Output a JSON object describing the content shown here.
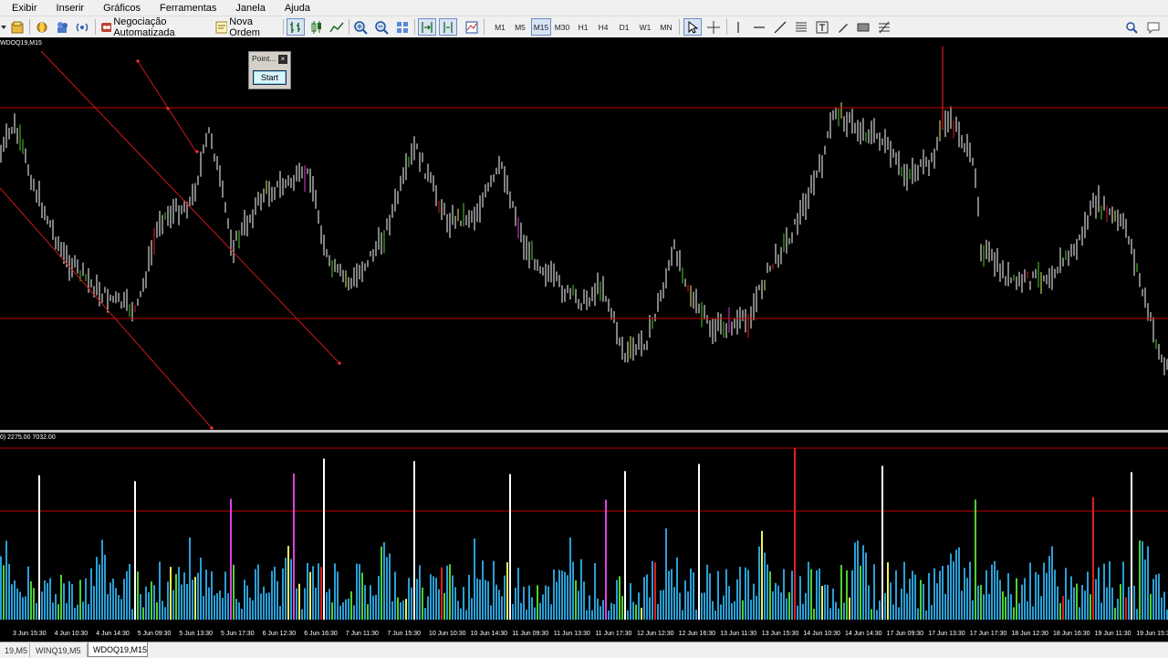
{
  "menu": [
    "Exibir",
    "Inserir",
    "Gráficos",
    "Ferramentas",
    "Janela",
    "Ajuda"
  ],
  "toolbar": {
    "algo_trading_label": "Negociação Automatizada",
    "new_order_label": "Nova Ordem",
    "timeframes": [
      "M1",
      "M5",
      "M15",
      "M30",
      "H1",
      "H4",
      "D1",
      "W1",
      "MN"
    ],
    "active_timeframe": "M15"
  },
  "chart": {
    "title": "WDOQ19,M15",
    "volume_label": "0) 2275.00 7032.00",
    "x_labels": [
      "3 Jun 15:30",
      "4 Jun 10:30",
      "4 Jun 14:30",
      "5 Jun 09:30",
      "5 Jun 13:30",
      "5 Jun 17:30",
      "6 Jun 12:30",
      "6 Jun 16:30",
      "7 Jun 11:30",
      "7 Jun 15:30",
      "10 Jun 10:30",
      "10 Jun 14:30",
      "11 Jun 09:30",
      "11 Jun 13:30",
      "11 Jun 17:30",
      "12 Jun 12:30",
      "12 Jun 16:30",
      "13 Jun 11:30",
      "13 Jun 15:30",
      "14 Jun 10:30",
      "14 Jun 14:30",
      "17 Jun 09:30",
      "17 Jun 13:30",
      "17 Jun 17:30",
      "18 Jun 12:30",
      "18 Jun 16:30",
      "19 Jun 11:30",
      "19 Jun 15:30"
    ],
    "colors": {
      "background": "#000000",
      "bar": "#ffffff",
      "level_line": "#c00000",
      "trend_line": "#d01818",
      "volume_blue": "#2a9fd6",
      "volume_green": "#4fd030",
      "volume_yellow": "#f0f060",
      "volume_red": "#e02020",
      "volume_magenta": "#e040e0"
    }
  },
  "panel": {
    "title": "Point...",
    "close": "×",
    "start_label": "Start"
  },
  "tabs": [
    "19,M5",
    "WINQ19,M5",
    "WDOQ19,M15"
  ],
  "active_tab": "WDOQ19,M15"
}
